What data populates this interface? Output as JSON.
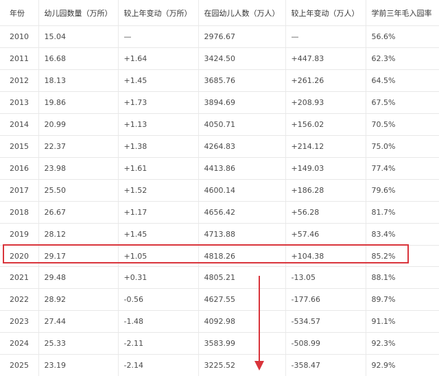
{
  "table": {
    "headers": [
      "年份",
      "幼儿园数量（万所）",
      "较上年变动（万所）",
      "在园幼儿人数（万人）",
      "较上年变动（万人）",
      "学前三年毛入园率"
    ],
    "rows": [
      [
        "2010",
        "15.04",
        "—",
        "2976.67",
        "—",
        "56.6%"
      ],
      [
        "2011",
        "16.68",
        "+1.64",
        "3424.50",
        "+447.83",
        "62.3%"
      ],
      [
        "2012",
        "18.13",
        "+1.45",
        "3685.76",
        "+261.26",
        "64.5%"
      ],
      [
        "2013",
        "19.86",
        "+1.73",
        "3894.69",
        "+208.93",
        "67.5%"
      ],
      [
        "2014",
        "20.99",
        "+1.13",
        "4050.71",
        "+156.02",
        "70.5%"
      ],
      [
        "2015",
        "22.37",
        "+1.38",
        "4264.83",
        "+214.12",
        "75.0%"
      ],
      [
        "2016",
        "23.98",
        "+1.61",
        "4413.86",
        "+149.03",
        "77.4%"
      ],
      [
        "2017",
        "25.50",
        "+1.52",
        "4600.14",
        "+186.28",
        "79.6%"
      ],
      [
        "2018",
        "26.67",
        "+1.17",
        "4656.42",
        "+56.28",
        "81.7%"
      ],
      [
        "2019",
        "28.12",
        "+1.45",
        "4713.88",
        "+57.46",
        "83.4%"
      ],
      [
        "2020",
        "29.17",
        "+1.05",
        "4818.26",
        "+104.38",
        "85.2%"
      ],
      [
        "2021",
        "29.48",
        "+0.31",
        "4805.21",
        "-13.05",
        "88.1%"
      ],
      [
        "2022",
        "28.92",
        "-0.56",
        "4627.55",
        "-177.66",
        "89.7%"
      ],
      [
        "2023",
        "27.44",
        "-1.48",
        "4092.98",
        "-534.57",
        "91.1%"
      ],
      [
        "2024",
        "25.33",
        "-2.11",
        "3583.99",
        "-508.99",
        "92.3%"
      ],
      [
        "2025",
        "23.19",
        "-2.14",
        "3225.52",
        "-358.47",
        "92.9%"
      ]
    ]
  },
  "annotations": {
    "highlight_color": "#d9343b",
    "highlight_row_year": "2020",
    "arrow_direction": "down"
  }
}
